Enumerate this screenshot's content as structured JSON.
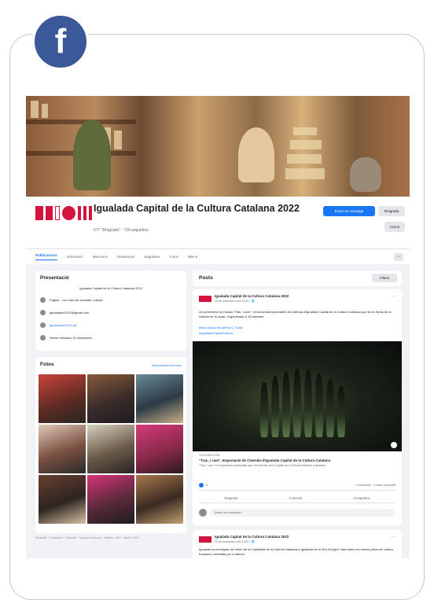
{
  "badge": {
    "letter": "f"
  },
  "page": {
    "name": "Igualada Capital de la Cultura Catalana 2022",
    "meta": "677 \"M'agrada\" · 724 seguidors"
  },
  "header_buttons": {
    "message": "Envia un missatge",
    "like": "M'agrada",
    "search": "Cerca"
  },
  "tabs": [
    {
      "label": "Publicacions",
      "active": true
    },
    {
      "label": "Informació"
    },
    {
      "label": "Mencions"
    },
    {
      "label": "Ressenyes"
    },
    {
      "label": "Seguidors"
    },
    {
      "label": "Fotos"
    },
    {
      "label": "Més ▾"
    }
  ],
  "tabs_more": "···",
  "presentation": {
    "title": "Presentació",
    "description": "Igualada Capital de la Cultura Catalana 2022",
    "rows": [
      {
        "text": "Pàgina · Lloc web de societat i cultura",
        "link": false
      },
      {
        "text": "igualadacc2022@gmail.com",
        "link": false
      },
      {
        "text": "igualadacc2022.cat",
        "link": true
      },
      {
        "text": "Sense valoració (0 ressenyes)",
        "link": false
      }
    ]
  },
  "photos": {
    "title": "Fotos",
    "see_all": "Mostra totes les fotos"
  },
  "footer": "Privacitat · Condicions · Publicitat · Opcions d'anuncis · Galetes · Més · Meta © 2022",
  "posts": {
    "title": "Posts",
    "filters": "Filtres"
  },
  "post": {
    "author": "Igualada Capital de la Cultura Catalana 2022",
    "date": "25 de novembre a les 10:23 · 🌐",
    "body": "Us presentem la música \"Trac, i cam\", l'emocionant espectacle de cloenda d'Igualada Capital de la Cultura Catalana que fa un repàs de la història de la ciutat. Organitzada a 15 escenes.",
    "link1": "https://youtu.be/g6PvfLC_DwM",
    "link2": "#IgualadaCapitalCultura",
    "caption_source": "YOUTUBE.COM",
    "caption_title": "\"Trac, i cam\". Espectacle de Cloenda d'Igualada Capital de la Cultura Catalana",
    "caption_sub": "\"Trac, i cam\" és l'espectacle participatiu que clou els fets de la Capital de la Cultura Catalana a Igualada.",
    "likes": "6",
    "shares": "1 comentari · 2 cops compartit",
    "actions": [
      "M'agrada",
      "Comenta",
      "Comparteix"
    ],
    "comment_placeholder": "Escriu un comentari..."
  },
  "post2": {
    "author": "Igualada Capital de la Cultura Catalana 2022",
    "date": "22 de novembre a les 18:00 · 🌐",
    "body": "Igualada fa el traspàs del relleu de la Capitalitat de la Cultura Catalana a Igualada de la Seu d'Urgell. Han estat uns mesos plens de cultura, trobades i activitats per a tothom."
  },
  "colors": {
    "facebook_blue": "#3b5998",
    "link_blue": "#1877f2",
    "brand_red": "#d3143f"
  }
}
